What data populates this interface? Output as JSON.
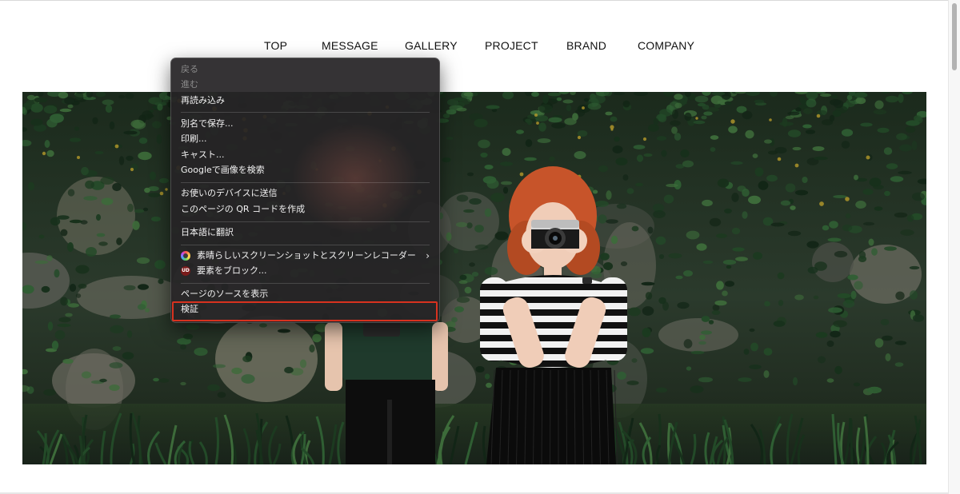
{
  "nav": {
    "items": [
      {
        "label": "TOP"
      },
      {
        "label": "MESSAGE"
      },
      {
        "label": "GALLERY"
      },
      {
        "label": "PROJECT"
      },
      {
        "label": "BRAND"
      },
      {
        "label": "COMPANY"
      }
    ]
  },
  "context_menu": {
    "back": "戻る",
    "forward": "進む",
    "reload": "再読み込み",
    "save_as": "別名で保存...",
    "print": "印刷...",
    "cast": "キャスト...",
    "search_image": "Googleで画像を検索",
    "send_to_devices": "お使いのデバイスに送信",
    "qr_code": "このページの QR コードを作成",
    "translate": "日本語に翻訳",
    "extension_screenshot": "素晴らしいスクリーンショットとスクリーンレコーダー",
    "block_element": "要素をブロック...",
    "view_source": "ページのソースを表示",
    "inspect": "検証",
    "ublock_badge": "UD"
  },
  "colors": {
    "highlight": "#d8321f",
    "menu_background": "#262426",
    "nav_text": "#111111"
  },
  "icons": {
    "extension": "screenshot-extension-icon",
    "ublock": "ublock-icon",
    "submenu": "chevron-right-icon"
  }
}
